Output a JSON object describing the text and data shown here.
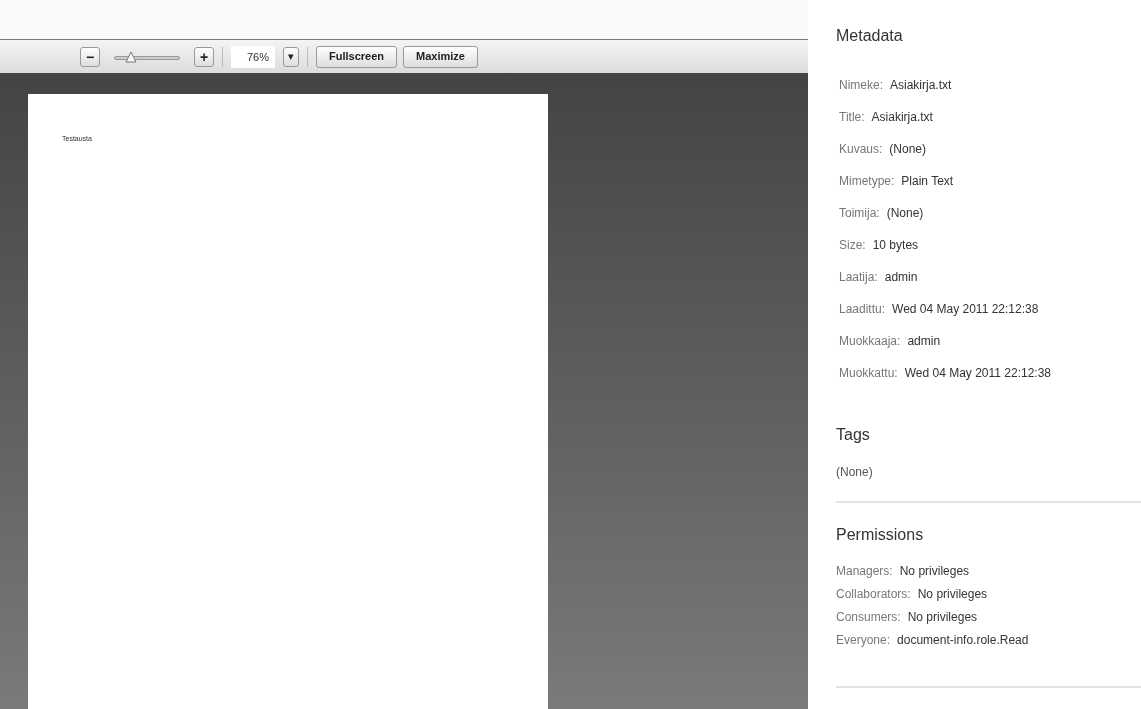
{
  "viewer": {
    "toolbar": {
      "zoom_out": "−",
      "zoom_slider": {
        "level": 0.25
      },
      "zoom_in": "+",
      "zoom_value": "76%",
      "zoom_menu": "▾",
      "buttons": [
        "Fullscreen",
        "Maximize"
      ]
    },
    "page_text": "Testausta"
  },
  "metadata": {
    "title": "Metadata",
    "fields": [
      {
        "label": "Nimeke:",
        "value": "Asiakirja.txt"
      },
      {
        "label": "Title:",
        "value": "Asiakirja.txt"
      },
      {
        "label": "Kuvaus:",
        "value": "(None)"
      },
      {
        "label": "Mimetype:",
        "value": "Plain Text"
      },
      {
        "label": "Toimija:",
        "value": "(None)"
      },
      {
        "label": "Size:",
        "value": "10 bytes"
      },
      {
        "label": "Laatija:",
        "value": "admin"
      },
      {
        "label": "Laadittu:",
        "value": "Wed 04 May 2011 22:12:38"
      },
      {
        "label": "Muokkaaja:",
        "value": "admin"
      },
      {
        "label": "Muokkattu:",
        "value": "Wed 04 May 2011 22:12:38"
      }
    ]
  },
  "tags": {
    "title": "Tags",
    "value": "(None)"
  },
  "permissions": {
    "title": "Permissions",
    "fields": [
      {
        "label": "Managers:",
        "value": "No privileges"
      },
      {
        "label": "Collaborators:",
        "value": "No privileges"
      },
      {
        "label": "Consumers:",
        "value": "No privileges"
      },
      {
        "label": "Everyone:",
        "value": "document-info.role.Read"
      }
    ]
  }
}
